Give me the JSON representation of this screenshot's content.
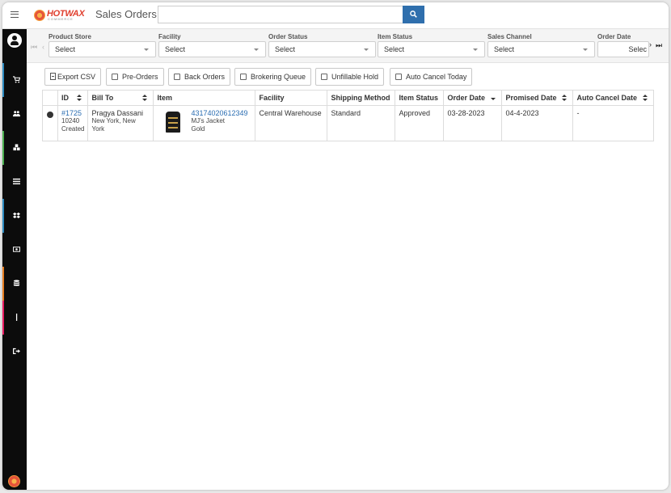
{
  "header": {
    "title": "Sales Orders",
    "search_value": "",
    "logo_text": "HOTWAX",
    "logo_sub": "COMMERCE"
  },
  "sidebar": {
    "items": [
      {
        "icon": "user-avatar-icon"
      },
      {
        "icon": "cart-icon"
      },
      {
        "icon": "users-icon"
      },
      {
        "icon": "cubes-icon"
      },
      {
        "icon": "list-icon"
      },
      {
        "icon": "dropbox-icon"
      },
      {
        "icon": "money-icon"
      },
      {
        "icon": "database-icon"
      },
      {
        "icon": "bar-icon"
      },
      {
        "icon": "sign-out-icon"
      }
    ],
    "accent_colors": [
      "#2e8bc0",
      "#4caf50",
      "#9b59b6",
      "#e67e22",
      "#e91e63"
    ]
  },
  "filters": [
    {
      "label": "Product Store",
      "value": "Select"
    },
    {
      "label": "Facility",
      "value": "Select"
    },
    {
      "label": "Order Status",
      "value": "Select"
    },
    {
      "label": "Item Status",
      "value": "Select"
    },
    {
      "label": "Sales Channel",
      "value": "Select"
    },
    {
      "label": "Order Date",
      "value": "Selec"
    }
  ],
  "toolbar": {
    "export_csv": "Export CSV",
    "pre_orders": "Pre-Orders",
    "back_orders": "Back Orders",
    "brokering_queue": "Brokering Queue",
    "unfillable_hold": "Unfillable Hold",
    "auto_cancel_today": "Auto Cancel Today"
  },
  "table": {
    "columns": [
      "ID",
      "Bill To",
      "Item",
      "Facility",
      "Shipping Method",
      "Item Status",
      "Order Date",
      "Promised Date",
      "Auto Cancel Date"
    ],
    "rows": [
      {
        "id": "#1725",
        "id_sub1": "10240",
        "id_sub2": "Created",
        "bill_to_name": "Pragya Dassani",
        "bill_to_location": "New York, New York",
        "item_id": "43174020612349",
        "item_name": "MJ's Jacket",
        "item_variant": "Gold",
        "facility": "Central Warehouse",
        "shipping_method": "Standard",
        "item_status": "Approved",
        "order_date": "03-28-2023",
        "promised_date": "04-4-2023",
        "auto_cancel_date": "-"
      }
    ]
  },
  "colors": {
    "primary": "#2f6fad",
    "link": "#2a6db2",
    "brand": "#e0402f"
  }
}
